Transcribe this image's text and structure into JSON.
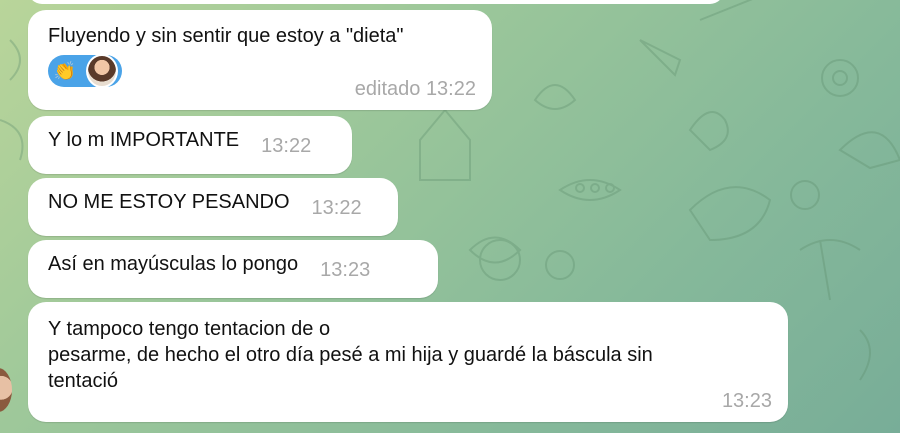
{
  "colors": {
    "bubble": "#ffffff",
    "timestamp": "#a8a8a8",
    "reaction_pill": "#4aa3e8",
    "wallpaper_start": "#b9d59a",
    "wallpaper_end": "#78ad98"
  },
  "messages": [
    {
      "text": "Fluyendo y sin sentir que estoy a \"dieta\"",
      "time": "editado 13:22",
      "reactions": [
        {
          "icon": "clapping-hands-icon",
          "glyph": "👏"
        },
        {
          "icon": "reactor-avatar"
        }
      ]
    },
    {
      "text": "Y lo m IMPORTANTE",
      "time": "13:22"
    },
    {
      "text": "NO ME ESTOY PESANDO",
      "time": "13:22"
    },
    {
      "text": "Así en mayúsculas lo pongo",
      "time": "13:23"
    },
    {
      "lines": [
        "Y tampoco tengo tentacion de o",
        "pesarme, de hecho el otro día pesé a mi hija y guardé la báscula sin",
        "tentació"
      ],
      "time": "13:23"
    }
  ]
}
